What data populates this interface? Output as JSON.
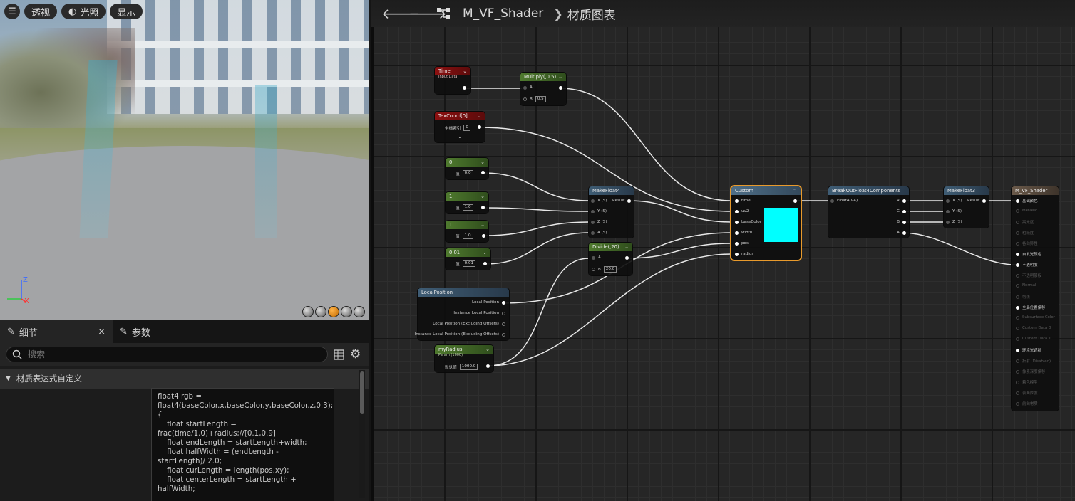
{
  "viewport": {
    "buttons": [
      "透视",
      "光照",
      "显示"
    ],
    "axis_z": "Z",
    "axis_x": "X"
  },
  "details": {
    "tab_details": "细节",
    "tab_params": "参数",
    "close": "×",
    "search_placeholder": "搜索",
    "section_title": "材质表达式自定义",
    "code": "float4 rgb = float4(baseColor.x,baseColor.y,baseColor.z,0.3);\n{\n    float startLength = frac(time/1.0)+radius;//[0.1,0.9]\n    float endLength = startLength+width;\n    float halfWidth = (endLength - startLength)/ 2.0;\n    float curLength = length(pos.xy);\n    float centerLength = startLength + halfWidth;\n\n    if(curLength > startLength && curLength <"
  },
  "graph": {
    "asset": "M_VF_Shader",
    "crumb": "材质图表",
    "nodes": {
      "time": {
        "title": "Time",
        "sub": "Input Data"
      },
      "multiply": {
        "title": "Multiply(,0.5)",
        "a": "A",
        "b": "B",
        "b_val": "0.5"
      },
      "texcoord": {
        "title": "TexCoord[0]",
        "label": "坐标索引",
        "val": "0"
      },
      "c0": {
        "title": "0",
        "label": "值",
        "val": "0.0"
      },
      "c1": {
        "title": "1",
        "label": "值",
        "val": "1.0"
      },
      "c2": {
        "title": "1",
        "label": "值",
        "val": "1.0"
      },
      "c3": {
        "title": "0.01",
        "label": "值",
        "val": "0.01"
      },
      "makefloat4": {
        "title": "MakeFloat4",
        "pins": [
          "X (S)",
          "Y (S)",
          "Z (S)",
          "A (S)"
        ],
        "out": "Result"
      },
      "divide": {
        "title": "Divide(,20)",
        "a": "A",
        "b": "B",
        "b_val": "20.0"
      },
      "localpos": {
        "title": "LocalPosition",
        "pins": [
          "Local Position",
          "Instance Local Position",
          "Local Position (Excluding Offsets)",
          "Instance Local Position (Excluding Offsets)"
        ]
      },
      "myradius": {
        "title": "myRadius",
        "sub": "Param (1000)",
        "label": "默认值",
        "val": "1000.0"
      },
      "custom": {
        "title": "Custom",
        "pins": [
          "time",
          "uv2",
          "baseColor",
          "width",
          "pos",
          "radius"
        ],
        "swatch": "#00ffff"
      },
      "breakout": {
        "title": "BreakOutFloat4Components",
        "in": "Float4(V4)",
        "outs": [
          "R",
          "G",
          "B",
          "A"
        ]
      },
      "makefloat3": {
        "title": "MakeFloat3",
        "pins": [
          "X (S)",
          "Y (S)",
          "Z (S)"
        ],
        "out": "Result"
      },
      "result": {
        "title": "M_VF_Shader",
        "pins": [
          {
            "label": "基础颜色",
            "on": true
          },
          {
            "label": "Metallic",
            "on": false
          },
          {
            "label": "高光度",
            "on": false
          },
          {
            "label": "粗糙度",
            "on": false
          },
          {
            "label": "各向异性",
            "on": false
          },
          {
            "label": "自发光颜色",
            "on": true
          },
          {
            "label": "不透明度",
            "on": true
          },
          {
            "label": "不透明蒙板",
            "on": false
          },
          {
            "label": "Normal",
            "on": false
          },
          {
            "label": "切线",
            "on": false
          },
          {
            "label": "全局位置偏移",
            "on": true
          },
          {
            "label": "Subsurface Color",
            "on": false
          },
          {
            "label": "Custom Data 0",
            "on": false
          },
          {
            "label": "Custom Data 1",
            "on": false
          },
          {
            "label": "环境光遮挡",
            "on": true
          },
          {
            "label": "折射 (Disabled)",
            "on": false
          },
          {
            "label": "像素深度偏移",
            "on": false
          },
          {
            "label": "着色模型",
            "on": false
          },
          {
            "label": "表面厚度",
            "on": false
          },
          {
            "label": "前向材质",
            "on": false
          }
        ]
      }
    }
  },
  "colors": {
    "accent_orange": "#e89a2c",
    "swatch": "#00ffff"
  }
}
